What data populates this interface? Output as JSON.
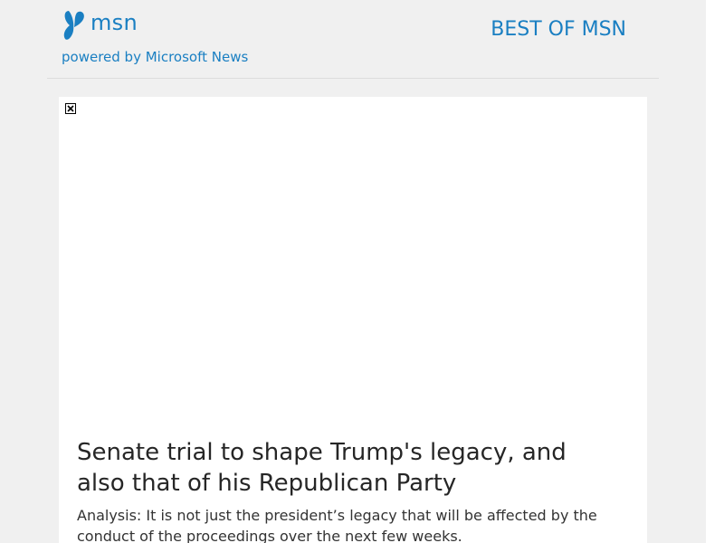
{
  "header": {
    "logo_text": "msn",
    "tagline": "powered by Microsoft News",
    "section_link": "BEST OF MSN"
  },
  "article": {
    "headline": "Senate trial to shape Trump's legacy, and also that of his Republican Party",
    "summary": "Analysis: It is not just the president’s legacy that will be affected by the conduct of the proceedings over the next few weeks."
  },
  "colors": {
    "brand_blue": "#1a7fc2",
    "page_background": "#f0f0f0",
    "card_background": "#ffffff",
    "headline_text": "#262626"
  },
  "icons": {
    "logo": "msn-butterfly-icon",
    "image_placeholder": "broken-image-icon"
  }
}
